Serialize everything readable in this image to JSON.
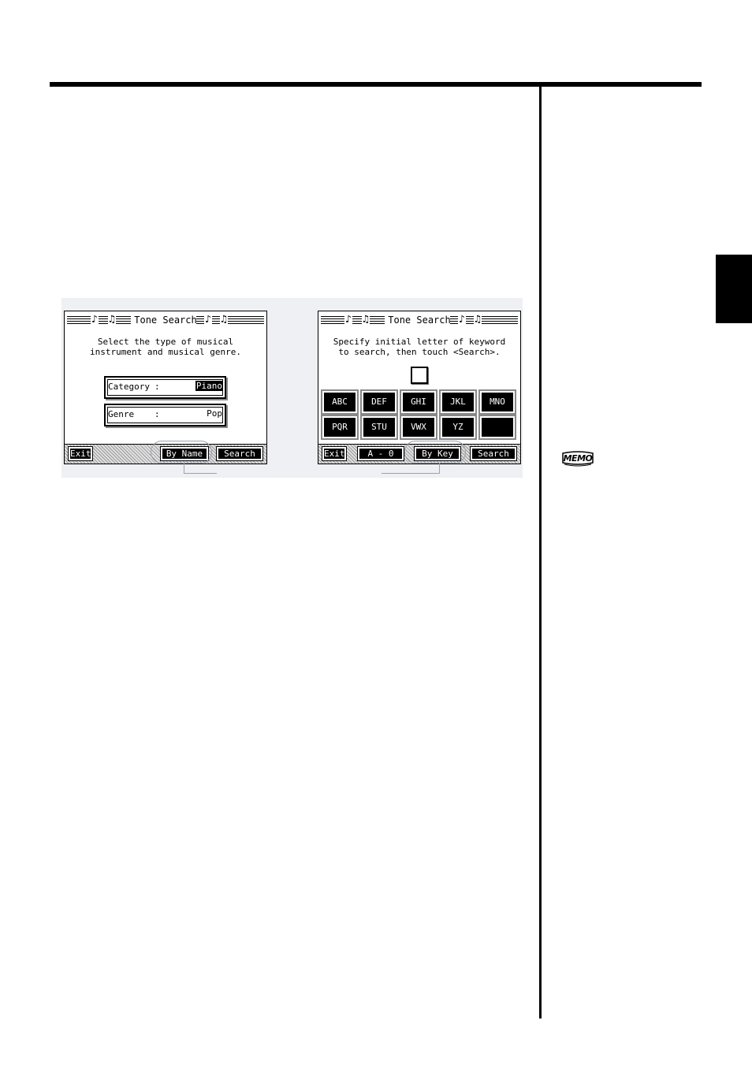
{
  "screen_a": {
    "title": "Tone Search",
    "prompt": "Select the type of musical\ninstrument and musical genre.",
    "category_label": "Category",
    "category_value": "Piano",
    "genre_label": "Genre",
    "genre_value": "Pop",
    "exit_label": "Exit",
    "by_name_label": "By Name",
    "search_label": "Search"
  },
  "screen_b": {
    "title": "Tone Search",
    "prompt": "Specify initial letter of keyword\nto search, then touch <Search>.",
    "keys": [
      "ABC",
      "DEF",
      "GHI",
      "JKL",
      "MNO",
      "PQR",
      "STU",
      "VWX",
      "YZ",
      ""
    ],
    "exit_label": "Exit",
    "range_label": "A - 0",
    "by_key_label": "By Key",
    "search_label": "Search"
  },
  "memo": {
    "label": "MEMO"
  }
}
